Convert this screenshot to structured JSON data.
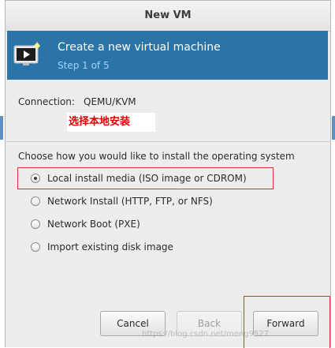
{
  "window": {
    "title": "New VM"
  },
  "banner": {
    "title": "Create a new virtual machine",
    "step": "Step 1 of 5",
    "icon": "vm-display-icon"
  },
  "connection": {
    "label": "Connection:",
    "value": "QEMU/KVM"
  },
  "annotation": {
    "text": "选择本地安装",
    "color": "#e00000"
  },
  "install": {
    "question": "Choose how you would like to install the operating system",
    "selected_index": 0,
    "options": [
      "Local install media (ISO image or CDROM)",
      "Network Install (HTTP, FTP, or NFS)",
      "Network Boot (PXE)",
      "Import existing disk image"
    ]
  },
  "buttons": {
    "cancel": "Cancel",
    "back": "Back",
    "forward": "Forward"
  },
  "watermark": "https://blog.csdn.net/meng9527",
  "colors": {
    "banner": "#2a74a8",
    "step_text": "#9fd3ff",
    "highlight": "#e03030"
  }
}
